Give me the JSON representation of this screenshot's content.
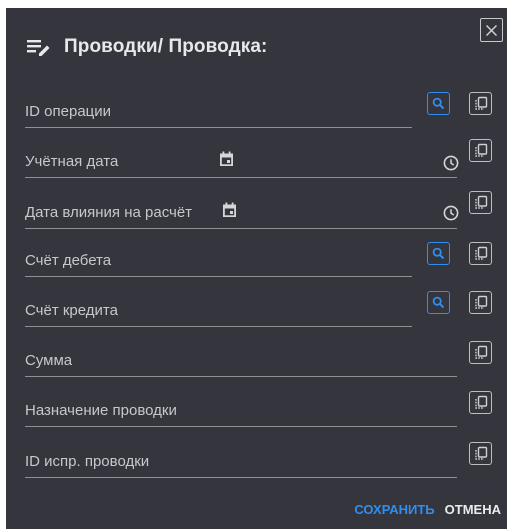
{
  "dialog": {
    "title": "Проводки/ Проводка:"
  },
  "fields": [
    {
      "id": "operation-id",
      "label": "ID операции",
      "value": ""
    },
    {
      "id": "accounting-date",
      "label": "Учётная дата",
      "value": ""
    },
    {
      "id": "settlement-date",
      "label": "Дата влияния на расчёт",
      "value": ""
    },
    {
      "id": "debit-account",
      "label": "Счёт дебета",
      "value": ""
    },
    {
      "id": "credit-account",
      "label": "Счёт кредита",
      "value": ""
    },
    {
      "id": "amount",
      "label": "Сумма",
      "value": ""
    },
    {
      "id": "purpose",
      "label": "Назначение проводки",
      "value": ""
    },
    {
      "id": "correction-id",
      "label": "ID испр. проводки",
      "value": ""
    }
  ],
  "footer": {
    "save_label": "СОХРАНИТЬ",
    "cancel_label": "ОТМЕНА"
  },
  "colors": {
    "dialog_bg": "#34353d",
    "accent": "#2f8ef0",
    "text": "#d6d6d9"
  },
  "icons": {
    "title": "edit-list-icon",
    "close": "close-icon",
    "search": "search-icon",
    "copy": "copy-icon",
    "calendar": "calendar-icon",
    "clock": "clock-icon"
  }
}
